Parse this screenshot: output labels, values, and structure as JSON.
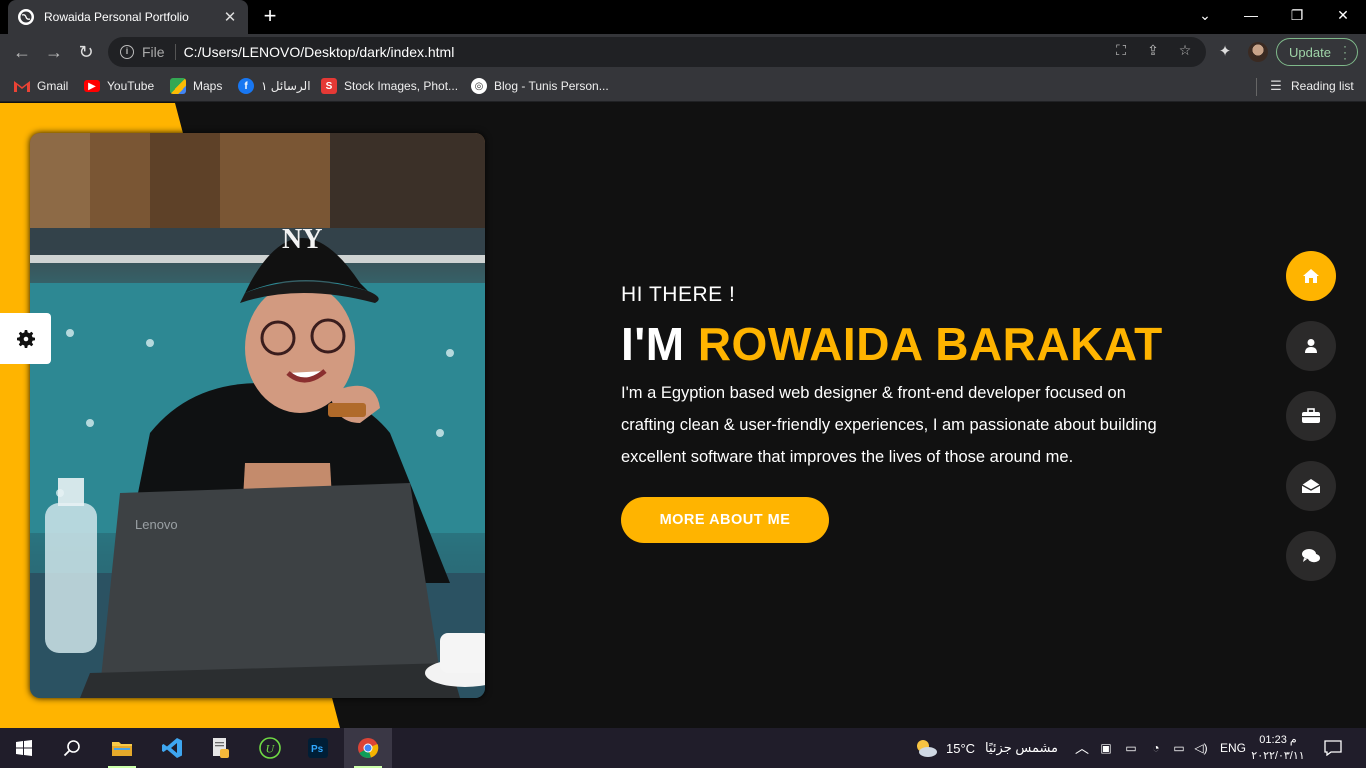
{
  "browser": {
    "tab_title": "Rowaida Personal Portfolio",
    "tab_close": "✕",
    "new_tab": "+",
    "address_scheme": "File",
    "address_url": "C:/Users/LENOVO/Desktop/dark/index.html",
    "update_label": "Update",
    "reading_list": "Reading list",
    "bookmarks": [
      {
        "label": "Gmail"
      },
      {
        "label": "YouTube"
      },
      {
        "label": "Maps"
      },
      {
        "label": "الرسائل ١"
      },
      {
        "label": "Stock Images, Phot..."
      },
      {
        "label": "Blog - Tunis Person..."
      }
    ]
  },
  "hero": {
    "greeting": "HI THERE !",
    "name_prefix": "I'M ",
    "name_highlight": "ROWAIDA BARAKAT",
    "description": "I'm a Egyption based web designer & front-end developer focused on crafting clean & user-friendly experiences, I am passionate about building excellent software that improves the lives of those around me.",
    "cta_label": "MORE ABOUT ME"
  },
  "photo": {
    "laptop_brand": "Lenovo"
  },
  "side_nav": [
    {
      "icon": "home-icon",
      "active": true
    },
    {
      "icon": "user-icon",
      "active": false
    },
    {
      "icon": "briefcase-icon",
      "active": false
    },
    {
      "icon": "envelope-icon",
      "active": false
    },
    {
      "icon": "comments-icon",
      "active": false
    }
  ],
  "colors": {
    "accent": "#ffb400",
    "page_bg": "#111111",
    "nav_bg": "#2b2a2a"
  },
  "taskbar": {
    "weather_temp": "15°C",
    "weather_text": "مشمس جزئيًا",
    "language": "ENG",
    "time": "01:23 م",
    "date": "٢٠٢٢/٠٣/١١"
  }
}
